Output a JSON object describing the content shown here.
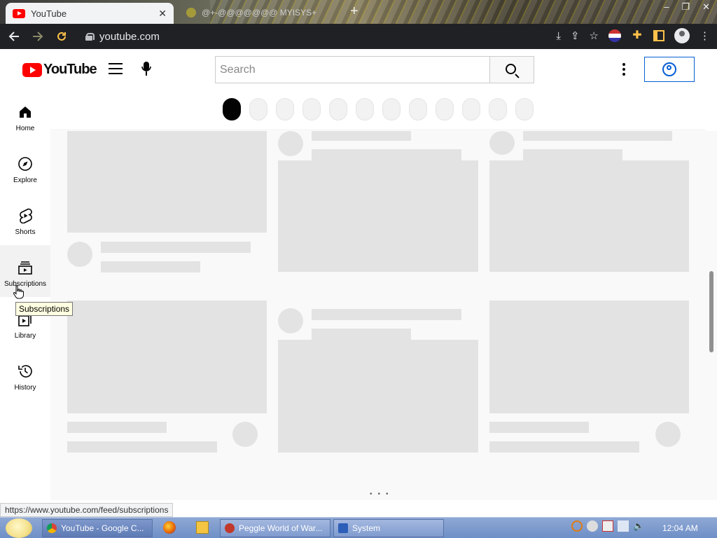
{
  "browser": {
    "active_tab": {
      "title": "YouTube",
      "close": "✕"
    },
    "inactive_tab": {
      "title": "@+-@@@@@@@ MYISYS+"
    },
    "new_tab": "+",
    "window_controls": [
      "–",
      "❐",
      "✕"
    ],
    "url": "youtube.com",
    "status_url": "https://www.youtube.com/feed/subscriptions"
  },
  "header": {
    "logo_text": "YouTube",
    "search_placeholder": "Search"
  },
  "sidebar": {
    "items": [
      {
        "label": "Home",
        "icon": "home-icon"
      },
      {
        "label": "Explore",
        "icon": "compass-icon"
      },
      {
        "label": "Shorts",
        "icon": "shorts-icon"
      },
      {
        "label": "Subscriptions",
        "icon": "subscriptions-icon"
      },
      {
        "label": "Library",
        "icon": "library-icon"
      },
      {
        "label": "History",
        "icon": "history-icon"
      }
    ],
    "hovered": "Subscriptions"
  },
  "tooltip": {
    "text": "Subscriptions"
  },
  "chips": {
    "count": 12,
    "selected_index": 0
  },
  "taskbar": {
    "buttons": [
      {
        "label": "YouTube - Google C...",
        "icon": "chrome-icon",
        "active": true
      },
      {
        "label": "Peggle World of War...",
        "icon": "peggle-icon",
        "active": false
      },
      {
        "label": "System",
        "icon": "system-icon",
        "active": false
      }
    ],
    "clock": "12:04 AM"
  },
  "colors": {
    "youtube_red": "#ff0000",
    "signin_blue": "#065fd4",
    "skeleton": "#e3e3e3",
    "toolbar": "#202124"
  }
}
